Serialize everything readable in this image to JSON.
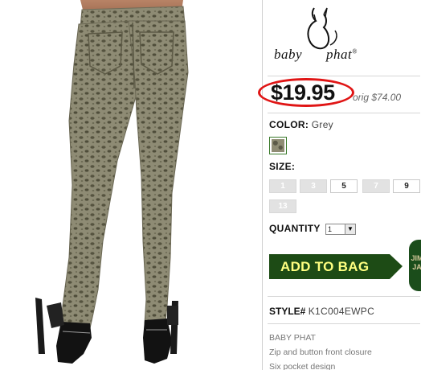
{
  "product": {
    "image_alt": "leopard print skinny jeans"
  },
  "brand": {
    "logo_text_1": "baby",
    "logo_text_2": "phat",
    "trademark": "®"
  },
  "price": {
    "sale": "$19.95",
    "orig": "orig $74.00"
  },
  "color": {
    "label": "COLOR:",
    "value": "Grey"
  },
  "size": {
    "label": "SIZE:",
    "options": [
      {
        "label": "1",
        "available": false
      },
      {
        "label": "3",
        "available": false
      },
      {
        "label": "5",
        "available": true
      },
      {
        "label": "7",
        "available": false
      },
      {
        "label": "9",
        "available": true
      },
      {
        "label": "13",
        "available": false
      }
    ]
  },
  "quantity": {
    "label": "QUANTITY",
    "value": "1"
  },
  "add_to_bag": "ADD TO BAG",
  "badge_text": "JIM JA",
  "style": {
    "label": "STYLE#",
    "value": "K1C004EWPC"
  },
  "description": {
    "lines": [
      "BABY PHAT",
      "Zip and button front closure",
      "Six pocket design"
    ]
  },
  "colors": {
    "price_circle": "#e01515",
    "add_to_bag_bg": "#1d4b15",
    "add_to_bag_text": "#ffff80"
  }
}
